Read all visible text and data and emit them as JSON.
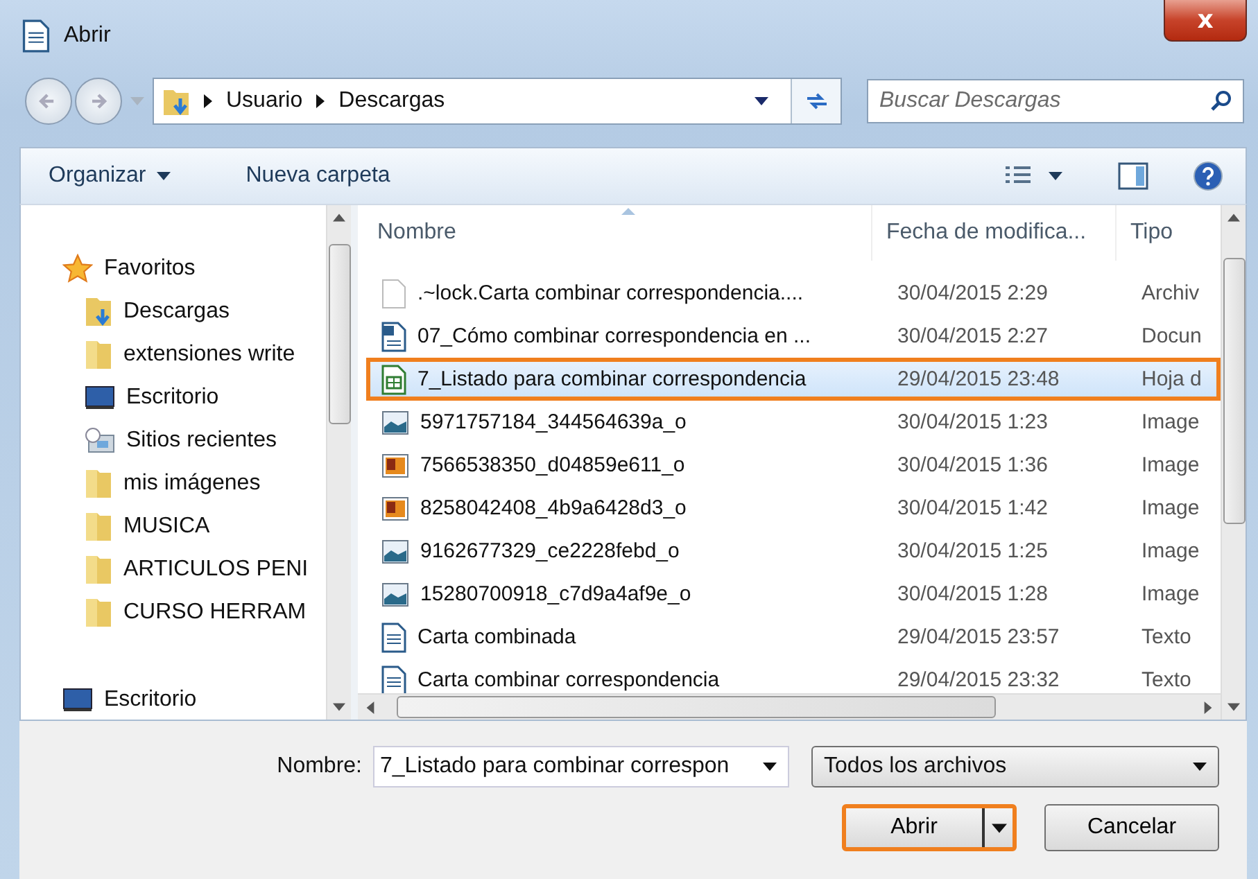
{
  "window": {
    "title": "Abrir",
    "close": "x"
  },
  "address": {
    "path": [
      {
        "label": "Usuario"
      },
      {
        "label": "Descargas"
      }
    ]
  },
  "search": {
    "placeholder": "Buscar Descargas"
  },
  "toolbar": {
    "items": [
      {
        "label": "Organizar",
        "dropdown": true
      },
      {
        "label": "Nueva carpeta",
        "dropdown": false
      }
    ]
  },
  "sidebar": {
    "items": [
      {
        "label": "Favoritos",
        "kind": "star",
        "children": [
          {
            "label": "Descargas",
            "kind": "download"
          },
          {
            "label": "extensiones write",
            "kind": "folder"
          },
          {
            "label": "Escritorio",
            "kind": "desktop"
          },
          {
            "label": "Sitios recientes",
            "kind": "recent"
          },
          {
            "label": "mis imágenes",
            "kind": "folder"
          },
          {
            "label": "MUSICA",
            "kind": "folder"
          },
          {
            "label": "ARTICULOS PENI",
            "kind": "folder"
          },
          {
            "label": "CURSO HERRAM",
            "kind": "folder"
          }
        ]
      },
      {
        "label": "Escritorio",
        "kind": "desktop"
      }
    ]
  },
  "table": {
    "columns": [
      {
        "label": "Nombre"
      },
      {
        "label": "Fecha de modifica..."
      },
      {
        "label": "Tipo"
      }
    ],
    "rows": [
      {
        "kind": "blank",
        "name": ".~lock.Carta combinar correspondencia....",
        "date": "30/04/2015 2:29",
        "type": "Archiv",
        "selected": false
      },
      {
        "kind": "writer",
        "name": "07_Cómo combinar correspondencia en ...",
        "date": "30/04/2015 2:27",
        "type": "Docun",
        "selected": false
      },
      {
        "kind": "calc",
        "name": "7_Listado para combinar correspondencia",
        "date": "29/04/2015 23:48",
        "type": "Hoja d",
        "selected": true
      },
      {
        "kind": "image",
        "name": "5971757184_344564639a_o",
        "date": "30/04/2015 1:23",
        "type": "Image",
        "selected": false
      },
      {
        "kind": "photo",
        "name": "7566538350_d04859e611_o",
        "date": "30/04/2015 1:36",
        "type": "Image",
        "selected": false
      },
      {
        "kind": "photo",
        "name": "8258042408_4b9a6428d3_o",
        "date": "30/04/2015 1:42",
        "type": "Image",
        "selected": false
      },
      {
        "kind": "image",
        "name": "9162677329_ce2228febd_o",
        "date": "30/04/2015 1:25",
        "type": "Image",
        "selected": false
      },
      {
        "kind": "image",
        "name": "15280700918_c7d9a4af9e_o",
        "date": "30/04/2015 1:28",
        "type": "Image",
        "selected": false
      },
      {
        "kind": "text",
        "name": "Carta combinada",
        "date": "29/04/2015 23:57",
        "type": "Texto",
        "selected": false
      },
      {
        "kind": "text",
        "name": "Carta combinar correspondencia",
        "date": "29/04/2015 23:32",
        "type": "Texto",
        "selected": false
      }
    ]
  },
  "filename": {
    "label": "Nombre:",
    "value": "7_Listado para combinar correspon"
  },
  "filter": {
    "value": "Todos los archivos"
  },
  "buttons": [
    {
      "label": "Abrir",
      "split": true,
      "highlighted": true
    },
    {
      "label": "Cancelar",
      "split": false,
      "highlighted": false
    }
  ]
}
